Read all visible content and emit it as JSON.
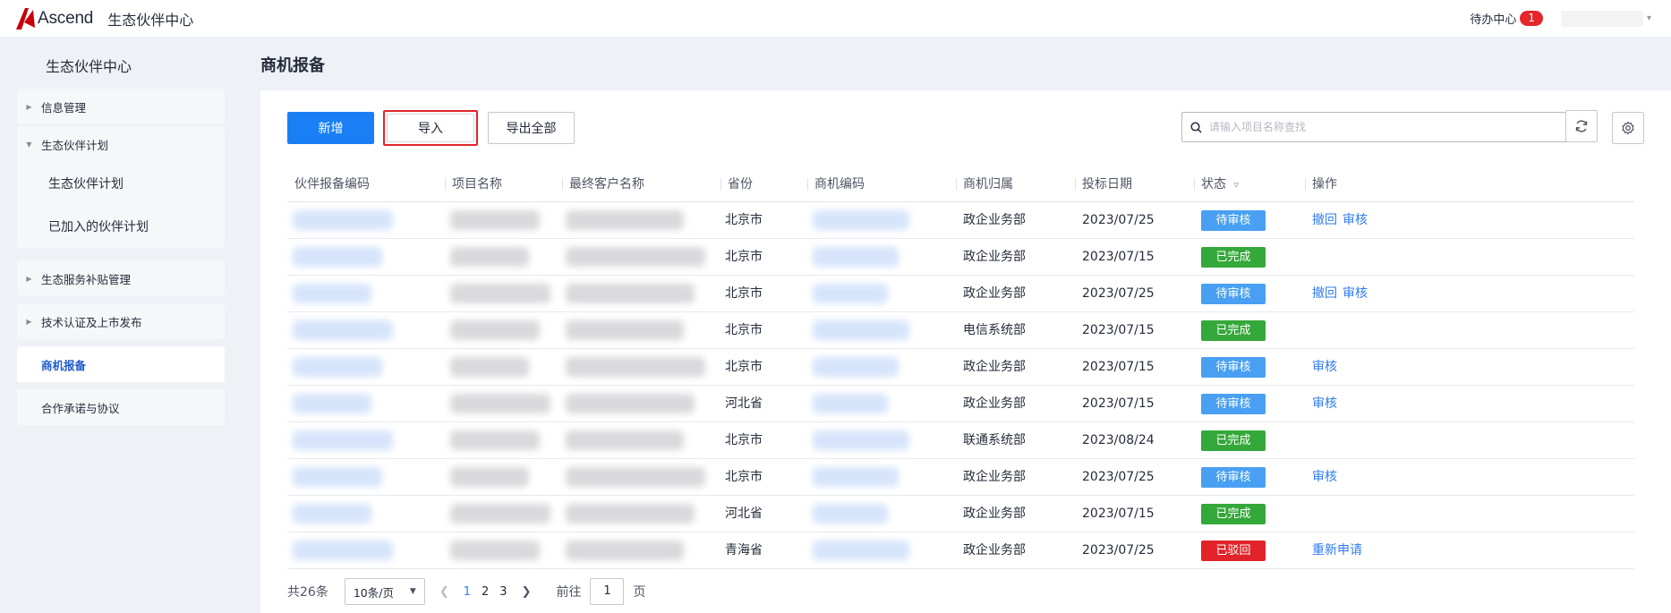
{
  "header": {
    "logo_text": "Ascend",
    "app_title": "生态伙伴中心",
    "todo_label": "待办中心",
    "todo_count": "1"
  },
  "sidebar": {
    "title": "生态伙伴中心",
    "groups": [
      {
        "label": "信息管理",
        "expanded": false
      },
      {
        "label": "生态伙伴计划",
        "expanded": true,
        "children": [
          "生态伙伴计划",
          "已加入的伙伴计划"
        ]
      },
      {
        "label": "生态服务补贴管理",
        "expanded": false
      },
      {
        "label": "技术认证及上市发布",
        "expanded": false
      },
      {
        "label": "商机报备",
        "active": true
      },
      {
        "label": "合作承诺与协议"
      }
    ]
  },
  "main": {
    "page_title": "商机报备",
    "toolbar": {
      "add_label": "新增",
      "import_label": "导入",
      "export_label": "导出全部",
      "search_placeholder": "请输入项目名称查找"
    },
    "table": {
      "columns": [
        "伙伴报备编码",
        "项目名称",
        "最终客户名称",
        "省份",
        "商机编码",
        "商机归属",
        "投标日期",
        "状态",
        "操作"
      ],
      "rows": [
        {
          "province": "北京市",
          "department": "政企业务部",
          "date": "2023/07/25",
          "status": "待审核",
          "status_kind": "pending",
          "ops": [
            "撤回",
            "审核"
          ]
        },
        {
          "province": "北京市",
          "department": "政企业务部",
          "date": "2023/07/15",
          "status": "已完成",
          "status_kind": "done",
          "ops": []
        },
        {
          "province": "北京市",
          "department": "政企业务部",
          "date": "2023/07/25",
          "status": "待审核",
          "status_kind": "pending",
          "ops": [
            "撤回",
            "审核"
          ]
        },
        {
          "province": "北京市",
          "department": "电信系统部",
          "date": "2023/07/15",
          "status": "已完成",
          "status_kind": "done",
          "ops": []
        },
        {
          "province": "北京市",
          "department": "政企业务部",
          "date": "2023/07/15",
          "status": "待审核",
          "status_kind": "pending",
          "ops": [
            "审核"
          ]
        },
        {
          "province": "河北省",
          "department": "政企业务部",
          "date": "2023/07/15",
          "status": "待审核",
          "status_kind": "pending",
          "ops": [
            "审核"
          ]
        },
        {
          "province": "北京市",
          "department": "联通系统部",
          "date": "2023/08/24",
          "status": "已完成",
          "status_kind": "done",
          "ops": []
        },
        {
          "province": "北京市",
          "department": "政企业务部",
          "date": "2023/07/25",
          "status": "待审核",
          "status_kind": "pending",
          "ops": [
            "审核"
          ]
        },
        {
          "province": "河北省",
          "department": "政企业务部",
          "date": "2023/07/15",
          "status": "已完成",
          "status_kind": "done",
          "ops": []
        },
        {
          "province": "青海省",
          "department": "政企业务部",
          "date": "2023/07/25",
          "status": "已驳回",
          "status_kind": "rejected",
          "ops": [
            "重新申请"
          ]
        }
      ]
    },
    "pagination": {
      "total_label": "共26条",
      "page_size": "10条/页",
      "pages": [
        "1",
        "2",
        "3"
      ],
      "current_page": "1",
      "goto_label": "前往",
      "goto_value": "1",
      "page_unit": "页"
    }
  },
  "colors": {
    "primary": "#1a7ff5",
    "status_pending": "#49a0f2",
    "status_done": "#34a83a",
    "status_rejected": "#e2232a",
    "highlight": "#e0262a"
  }
}
